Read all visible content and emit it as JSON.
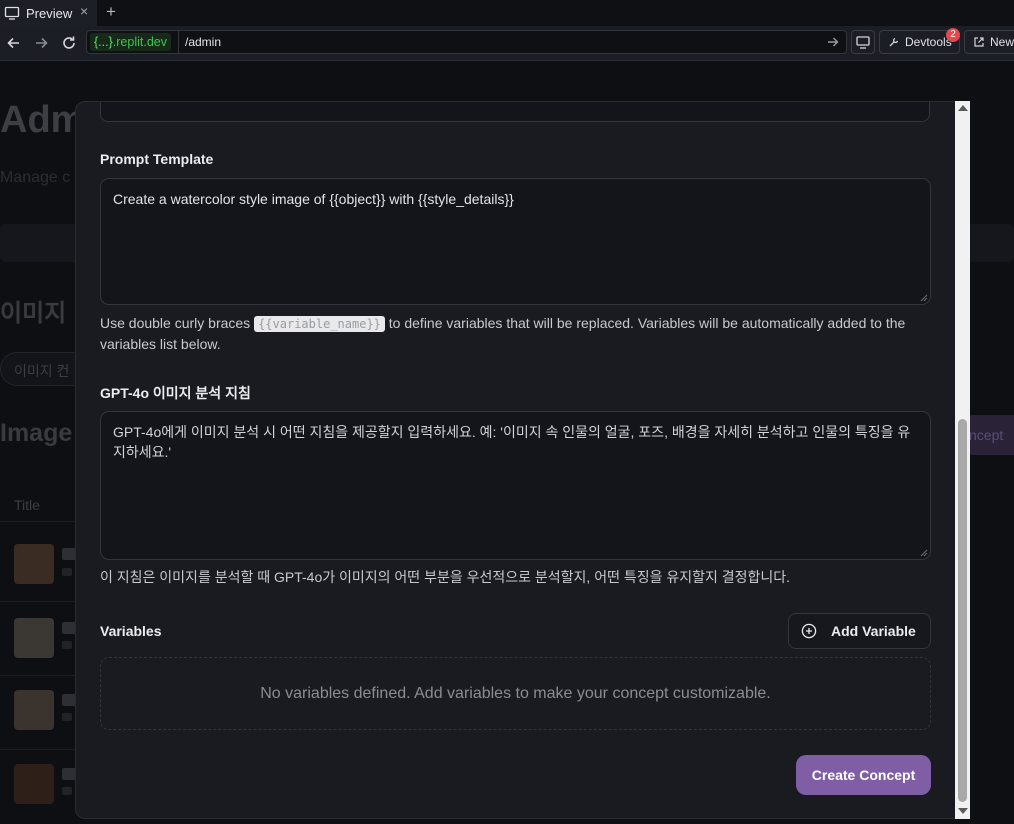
{
  "browser": {
    "tab_title": "Preview",
    "tab_close": "×",
    "new_tab": "+",
    "url_host": ".replit.dev",
    "url_host_prefix": "{...}",
    "url_path": "/admin",
    "devtools_label": "Devtools",
    "devtools_badge": "2",
    "new_label": "New"
  },
  "background": {
    "title": "Adm",
    "subtitle": "Manage c",
    "section_title": "이미지",
    "pill": "이미지 컨",
    "images_title": "Image",
    "right_button": "ncept",
    "column_title": "Title"
  },
  "modal": {
    "prompt_template": {
      "label": "Prompt Template",
      "value": "Create a watercolor style image of {{object}} with {{style_details}}",
      "help_before": "Use double curly braces",
      "help_code": "{{variable_name}}",
      "help_after": "to define variables that will be replaced. Variables will be automatically added to the variables list below."
    },
    "analysis": {
      "label": "GPT-4o 이미지 분석 지침",
      "placeholder": "GPT-4o에게 이미지 분석 시 어떤 지침을 제공할지 입력하세요. 예: '이미지 속 인물의 얼굴, 포즈, 배경을 자세히 분석하고 인물의 특징을 유지하세요.'",
      "help": "이 지침은 이미지를 분석할 때 GPT-4o가 이미지의 어떤 부분을 우선적으로 분석할지, 어떤 특징을 유지할지 결정합니다."
    },
    "variables": {
      "label": "Variables",
      "add_button": "Add Variable",
      "empty_text": "No variables defined. Add variables to make your concept customizable."
    },
    "create_button": "Create Concept"
  },
  "colors": {
    "accent": "#7f5ea6",
    "url_green": "#42c24e",
    "badge_red": "#e5484d"
  }
}
